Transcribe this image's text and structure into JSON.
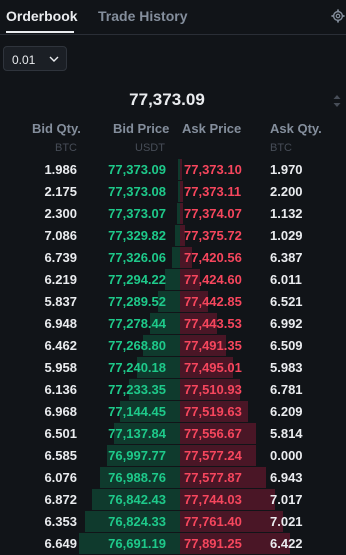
{
  "tabs": [
    {
      "label": "Orderbook",
      "active": true
    },
    {
      "label": "Trade History",
      "active": false
    }
  ],
  "precision": {
    "value": "0.01"
  },
  "last_price": "77,373.09",
  "columns": {
    "bid_qty": "Bid Qty.",
    "bid_price": "Bid Price",
    "ask_price": "Ask Price",
    "ask_qty": "Ask Qty.",
    "bid_qty_unit": "BTC",
    "bid_price_unit": "USDT",
    "ask_qty_unit": "BTC"
  },
  "colors": {
    "bid": "#1ec98a",
    "ask": "#f6465d",
    "bid_bar": "#0f3a2d",
    "ask_bar": "#4a1626"
  },
  "rows": [
    {
      "bid_qty": "1.986",
      "bid_price": "77,373.09",
      "ask_price": "77,373.10",
      "ask_qty": "1.970",
      "bid_depth": 0.01,
      "ask_depth": 0.01
    },
    {
      "bid_qty": "2.175",
      "bid_price": "77,373.08",
      "ask_price": "77,373.11",
      "ask_qty": "2.200",
      "bid_depth": 0.01,
      "ask_depth": 0.02
    },
    {
      "bid_qty": "2.300",
      "bid_price": "77,373.07",
      "ask_price": "77,374.07",
      "ask_qty": "1.132",
      "bid_depth": 0.02,
      "ask_depth": 0.02
    },
    {
      "bid_qty": "7.086",
      "bid_price": "77,329.82",
      "ask_price": "77,375.72",
      "ask_qty": "1.029",
      "bid_depth": 0.03,
      "ask_depth": 0.03
    },
    {
      "bid_qty": "6.739",
      "bid_price": "77,326.06",
      "ask_price": "77,420.56",
      "ask_qty": "6.387",
      "bid_depth": 0.05,
      "ask_depth": 0.07
    },
    {
      "bid_qty": "6.219",
      "bid_price": "77,294.22",
      "ask_price": "77,424.60",
      "ask_qty": "6.011",
      "bid_depth": 0.09,
      "ask_depth": 0.12
    },
    {
      "bid_qty": "5.837",
      "bid_price": "77,289.52",
      "ask_price": "77,442.85",
      "ask_qty": "6.521",
      "bid_depth": 0.13,
      "ask_depth": 0.17
    },
    {
      "bid_qty": "6.948",
      "bid_price": "77,278.44",
      "ask_price": "77,443.53",
      "ask_qty": "6.992",
      "bid_depth": 0.18,
      "ask_depth": 0.22
    },
    {
      "bid_qty": "6.462",
      "bid_price": "77,268.80",
      "ask_price": "77,491.35",
      "ask_qty": "6.509",
      "bid_depth": 0.22,
      "ask_depth": 0.28
    },
    {
      "bid_qty": "5.958",
      "bid_price": "77,240.18",
      "ask_price": "77,495.01",
      "ask_qty": "5.983",
      "bid_depth": 0.26,
      "ask_depth": 0.32
    },
    {
      "bid_qty": "6.136",
      "bid_price": "77,233.35",
      "ask_price": "77,510.93",
      "ask_qty": "6.781",
      "bid_depth": 0.31,
      "ask_depth": 0.36
    },
    {
      "bid_qty": "6.968",
      "bid_price": "77,144.45",
      "ask_price": "77,519.63",
      "ask_qty": "6.209",
      "bid_depth": 0.36,
      "ask_depth": 0.41
    },
    {
      "bid_qty": "6.501",
      "bid_price": "77,137.84",
      "ask_price": "77,556.67",
      "ask_qty": "5.814",
      "bid_depth": 0.4,
      "ask_depth": 0.46
    },
    {
      "bid_qty": "6.585",
      "bid_price": "76,997.77",
      "ask_price": "77,577.24",
      "ask_qty": "0.000",
      "bid_depth": 0.44,
      "ask_depth": 0.46
    },
    {
      "bid_qty": "6.076",
      "bid_price": "76,988.76",
      "ask_price": "77,577.87",
      "ask_qty": "6.943",
      "bid_depth": 0.48,
      "ask_depth": 0.52
    },
    {
      "bid_qty": "6.872",
      "bid_price": "76,842.43",
      "ask_price": "77,744.03",
      "ask_qty": "7.017",
      "bid_depth": 0.53,
      "ask_depth": 0.57
    },
    {
      "bid_qty": "6.353",
      "bid_price": "76,824.33",
      "ask_price": "77,761.40",
      "ask_qty": "7.021",
      "bid_depth": 0.57,
      "ask_depth": 0.62
    },
    {
      "bid_qty": "6.649",
      "bid_price": "76,691.19",
      "ask_price": "77,891.25",
      "ask_qty": "6.422",
      "bid_depth": 0.61,
      "ask_depth": 0.66
    }
  ]
}
